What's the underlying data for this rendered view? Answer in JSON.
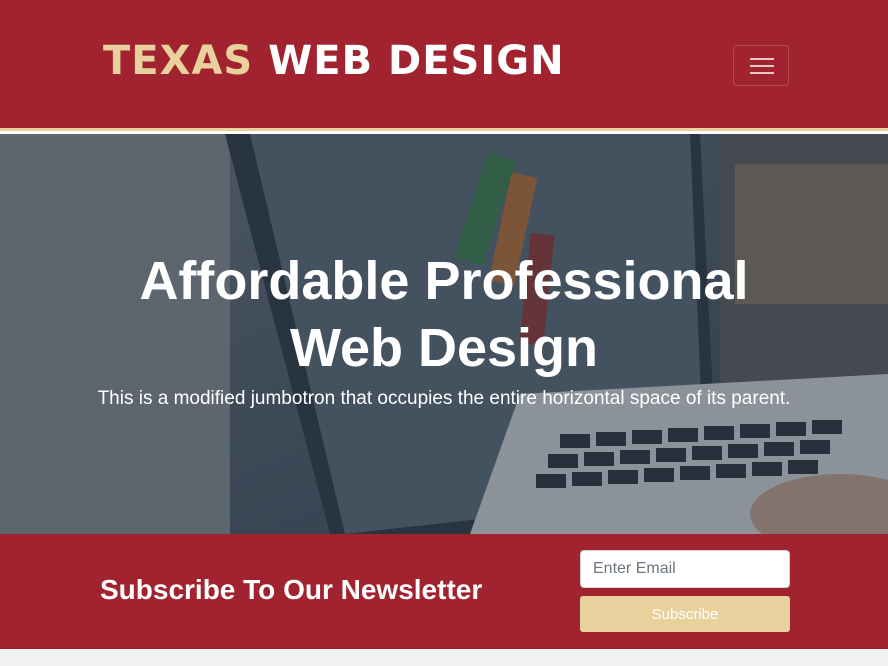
{
  "navbar": {
    "brand_part1": "TEXAS",
    "brand_part2": "WEB DESIGN",
    "toggler_icon": "hamburger-menu-icon",
    "colors": {
      "background": "#a0232f",
      "accent": "#e8d19c"
    }
  },
  "hero": {
    "title": "Affordable Professional Web Design",
    "lead": "This is a modified jumbotron that occupies the entire horizontal space of its parent."
  },
  "newsletter": {
    "heading": "Subscribe To Our Newsletter",
    "email_placeholder": "Enter Email",
    "subscribe_label": "Subscribe"
  }
}
